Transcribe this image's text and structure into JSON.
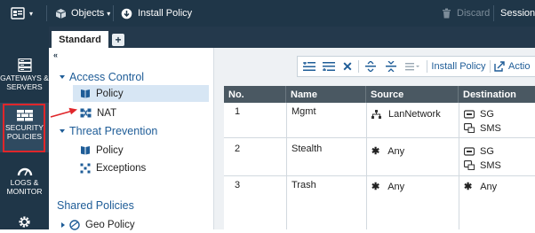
{
  "topbar": {
    "objects_label": "Objects",
    "install_policy_label": "Install Policy",
    "discard_label": "Discard",
    "session_label": "Session"
  },
  "leftnav": {
    "items": [
      {
        "label": "GATEWAYS & SERVERS",
        "icon": "server-stack-icon"
      },
      {
        "label": "SECURITY POLICIES",
        "icon": "brick-wall-icon",
        "active": true
      },
      {
        "label": "LOGS & MONITOR",
        "icon": "gauge-icon"
      },
      {
        "icon": "gear-icon"
      }
    ]
  },
  "tabs": {
    "active_label": "Standard",
    "add_label": "+"
  },
  "tree": {
    "collapse_label": "«",
    "access_control": {
      "label": "Access Control",
      "children": [
        {
          "label": "Policy",
          "selected": true
        },
        {
          "label": "NAT"
        }
      ]
    },
    "threat_prevention": {
      "label": "Threat Prevention",
      "children": [
        {
          "label": "Policy"
        },
        {
          "label": "Exceptions"
        }
      ]
    },
    "shared_policies": {
      "label": "Shared Policies",
      "children": [
        {
          "label": "Geo Policy"
        }
      ]
    }
  },
  "toolbar": {
    "install_policy_label": "Install Policy",
    "actions_label": "Actio"
  },
  "table": {
    "columns": [
      "No.",
      "Name",
      "Source",
      "Destination"
    ],
    "rows": [
      {
        "no": "1",
        "name": "Mgmt",
        "source": "LanNetwork",
        "destination": [
          "SG",
          "SMS"
        ]
      },
      {
        "no": "2",
        "name": "Stealth",
        "source": "Any",
        "destination": [
          "SG",
          "SMS"
        ]
      },
      {
        "no": "3",
        "name": "Trash",
        "source": "Any",
        "destination": [
          "Any"
        ]
      }
    ]
  },
  "colors": {
    "nav_bg": "#1f3648",
    "highlight_red": "#e0262a",
    "section_blue": "#1e5c97",
    "header_gray": "#4a5862",
    "selected_row": "#d7e6f4"
  }
}
